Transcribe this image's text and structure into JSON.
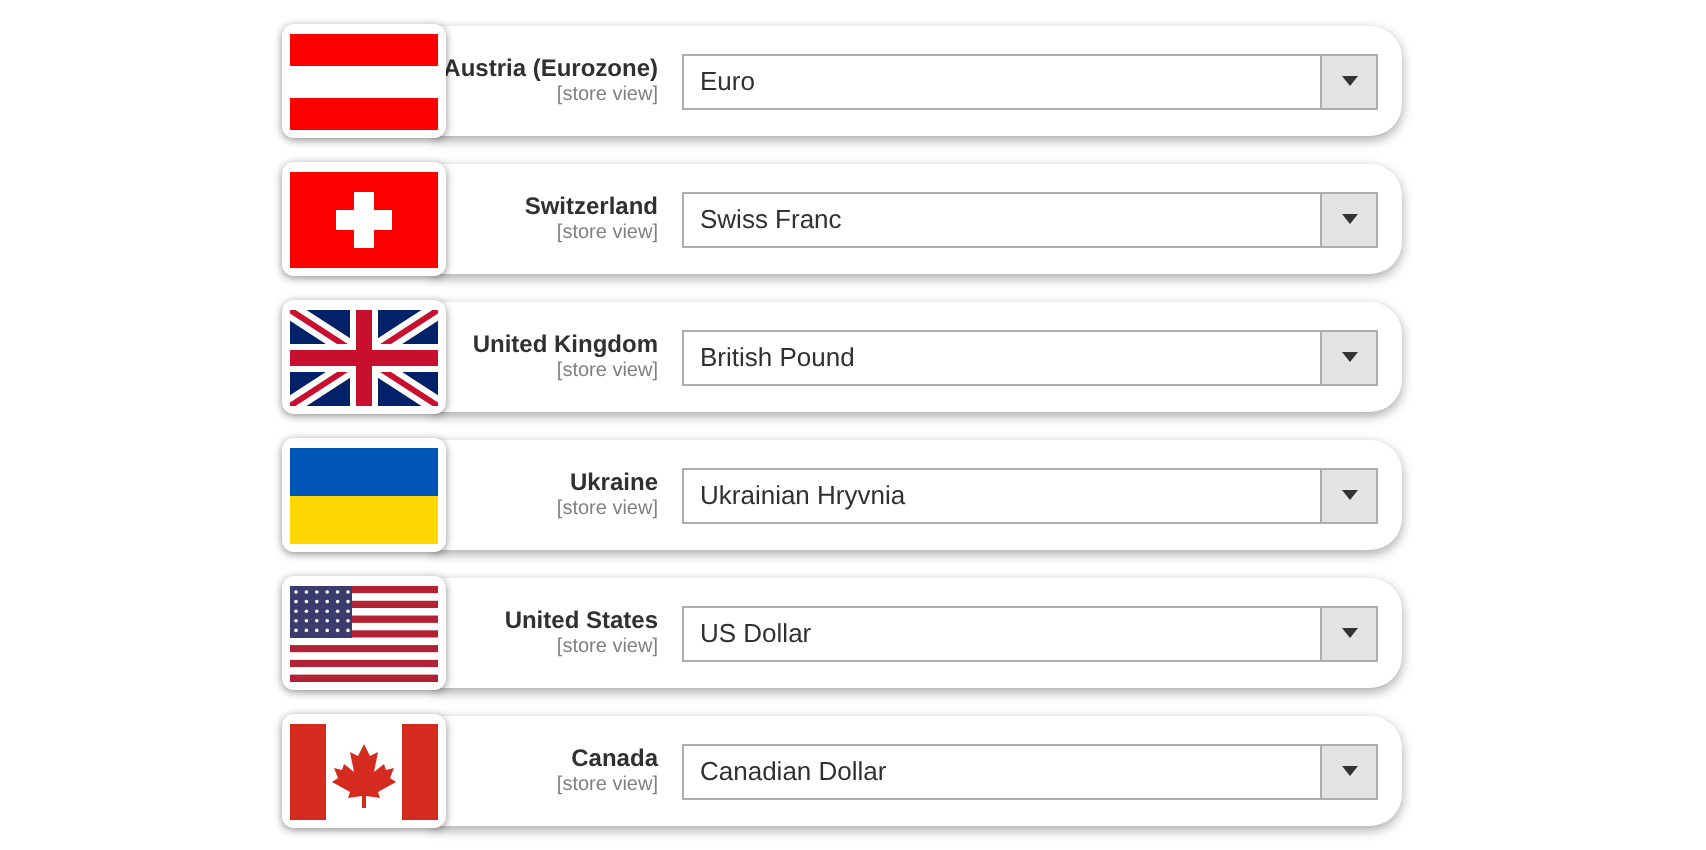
{
  "store_views": [
    {
      "name": "Austria (Eurozone)",
      "scope": "[store view]",
      "currency": "Euro"
    },
    {
      "name": "Switzerland",
      "scope": "[store view]",
      "currency": "Swiss Franc"
    },
    {
      "name": "United Kingdom",
      "scope": "[store view]",
      "currency": "British Pound"
    },
    {
      "name": "Ukraine",
      "scope": "[store view]",
      "currency": "Ukrainian Hryvnia"
    },
    {
      "name": "United States",
      "scope": "[store view]",
      "currency": "US Dollar"
    },
    {
      "name": "Canada",
      "scope": "[store view]",
      "currency": "Canadian Dollar"
    }
  ]
}
